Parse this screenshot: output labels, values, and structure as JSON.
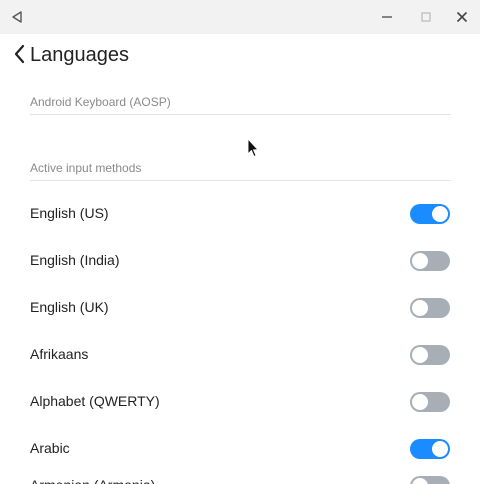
{
  "titlebar": {
    "back_icon": "triangle-left-icon",
    "minimize_icon": "minimize-icon",
    "maximize_icon": "maximize-icon",
    "close_icon": "close-icon"
  },
  "appbar": {
    "back_icon": "chevron-left-icon",
    "title": "Languages"
  },
  "sections": {
    "aosp": "Android Keyboard (AOSP)",
    "active": "Active input methods"
  },
  "colors": {
    "accent": "#1a8cff",
    "toggle_off": "#a7aeb6"
  },
  "input_methods": [
    {
      "label": "English (US)",
      "enabled": true
    },
    {
      "label": "English (India)",
      "enabled": false
    },
    {
      "label": "English (UK)",
      "enabled": false
    },
    {
      "label": "Afrikaans",
      "enabled": false
    },
    {
      "label": "Alphabet (QWERTY)",
      "enabled": false
    },
    {
      "label": "Arabic",
      "enabled": true
    },
    {
      "label": "Armenian (Armenia)",
      "enabled": false
    }
  ]
}
